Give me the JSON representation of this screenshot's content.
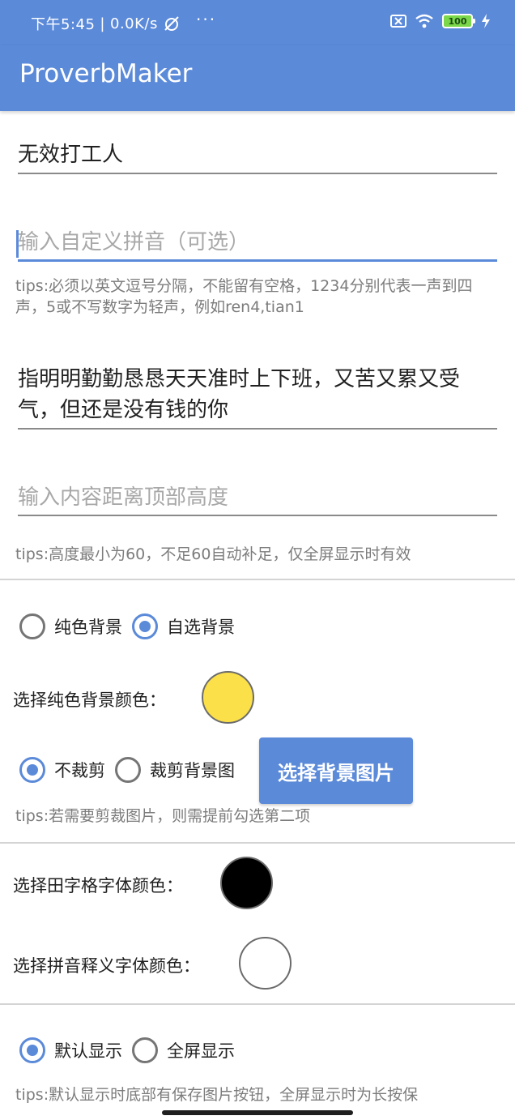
{
  "status_bar": {
    "time": "下午5:45",
    "separator": "|",
    "network_speed": "0.0K/s",
    "more": "···",
    "battery": "100",
    "icons": [
      "alarm-off-icon",
      "sim-off-icon",
      "wifi-icon",
      "battery-icon",
      "charging-icon"
    ]
  },
  "app_bar": {
    "title": "ProverbMaker"
  },
  "form": {
    "word_value": "无效打工人",
    "pinyin_placeholder": "输入自定义拼音（可选）",
    "pinyin_tips": "tips:必须以英文逗号分隔，不能留有空格，1234分别代表一声到四声，5或不写数字为轻声，例如ren4,tian1",
    "meaning_value": "指明明勤勤恳恳天天准时上下班，又苦又累又受气，但还是没有钱的你",
    "height_placeholder": "输入内容距离顶部高度",
    "height_tips": "tips:高度最小为60，不足60自动补足，仅全屏显示时有效"
  },
  "background": {
    "options": [
      {
        "label": "纯色背景",
        "selected": false
      },
      {
        "label": "自选背景",
        "selected": true
      }
    ],
    "solid_color_label": "选择纯色背景颜色：",
    "solid_color": "#fbe04a",
    "crop_options": [
      {
        "label": "不裁剪",
        "selected": true
      },
      {
        "label": "裁剪背景图",
        "selected": false
      }
    ],
    "pick_image_button": "选择背景图片",
    "crop_tips": "tips:若需要剪裁图片，则需提前勾选第二项"
  },
  "fonts": {
    "grid_color_label": "选择田字格字体颜色：",
    "grid_color": "#000000",
    "pinyin_color_label": "选择拼音释义字体颜色：",
    "pinyin_color": "#ffffff"
  },
  "display": {
    "options": [
      {
        "label": "默认显示",
        "selected": true
      },
      {
        "label": "全屏显示",
        "selected": false
      }
    ],
    "tips": "tips:默认显示时底部有保存图片按钮，全屏显示时为长按保"
  },
  "theme": {
    "accent": "#5b8ad9"
  }
}
